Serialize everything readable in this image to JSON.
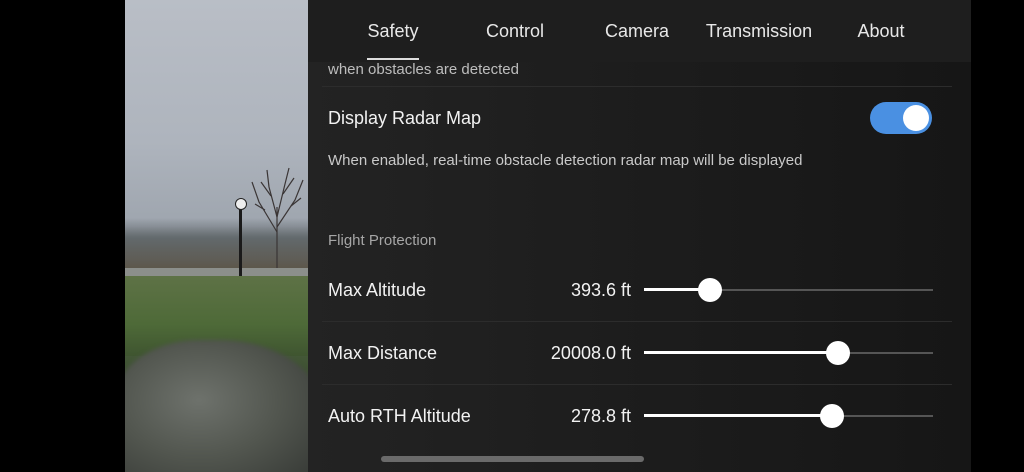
{
  "tabs": [
    {
      "label": "Safety",
      "active": true
    },
    {
      "label": "Control",
      "active": false
    },
    {
      "label": "Camera",
      "active": false
    },
    {
      "label": "Transmission",
      "active": false
    },
    {
      "label": "About",
      "active": false
    }
  ],
  "obstacle_note": "when obstacles are detected",
  "radar_map": {
    "title": "Display Radar Map",
    "enabled": true,
    "description": "When enabled, real-time obstacle detection radar map will be displayed"
  },
  "flight_protection": {
    "section_label": "Flight Protection",
    "settings": [
      {
        "label": "Max Altitude",
        "value": "393.6 ft",
        "level": 0.23
      },
      {
        "label": "Max Distance",
        "value": "20008.0 ft",
        "level": 0.67
      },
      {
        "label": "Auto RTH Altitude",
        "value": "278.8 ft",
        "level": 0.65
      }
    ]
  },
  "colors": {
    "toggle_on": "#4a90e2",
    "panel_bg": "#1b1b1b"
  }
}
